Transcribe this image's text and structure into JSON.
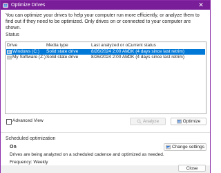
{
  "window": {
    "title": "Optimize Drives",
    "close_glyph": "✕"
  },
  "description": "You can optimize your drives to help your computer run more efficiently, or analyze them to find out if they need to be optimized. Only drives on or connected to your computer are shown.",
  "status": {
    "label": "Status",
    "columns": [
      "Drive",
      "Media type",
      "Last analyzed or o...",
      "Current status"
    ],
    "drives": [
      {
        "drive": "Windows (C:)",
        "media_type": "Solid state drive",
        "last_analyzed": "8/26/2024 2:00 AM",
        "current_status": "OK (4 days since last retrim)",
        "selected": true,
        "icon": "windows-drive-icon"
      },
      {
        "drive": "My Software (Z:)",
        "media_type": "Solid state drive",
        "last_analyzed": "8/26/2024 2:00 AM",
        "current_status": "OK (4 days since last retrim)",
        "selected": false,
        "icon": "drive-icon"
      }
    ]
  },
  "advanced_view": {
    "label": "Advanced View",
    "checked": false
  },
  "buttons": {
    "analyze": "Analyze",
    "optimize": "Optimize",
    "change_settings": "Change settings",
    "close": "Close"
  },
  "scheduled": {
    "label": "Scheduled optimization",
    "state": "On",
    "description": "Drives are being analyzed on a scheduled cadence and optimized as needed.",
    "frequency": "Frequency: Weekly"
  },
  "colors": {
    "titlebar": "#7a1d98",
    "selection": "#0078d7"
  }
}
